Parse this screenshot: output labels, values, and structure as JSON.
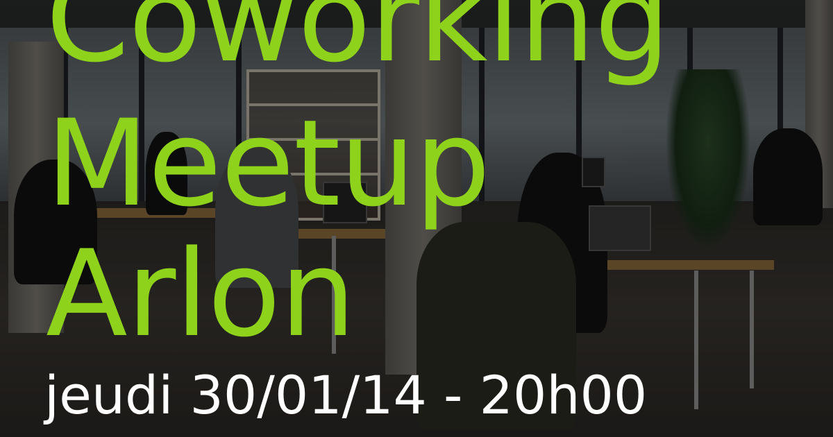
{
  "poster": {
    "title_line_1": "Coworking",
    "title_line_2": "Meetup",
    "title_line_3": "Arlon",
    "date_line": "jeudi 30/01/14 - 20h00"
  },
  "colors": {
    "title_green": "#8fd21b",
    "date_white": "#ffffff"
  }
}
